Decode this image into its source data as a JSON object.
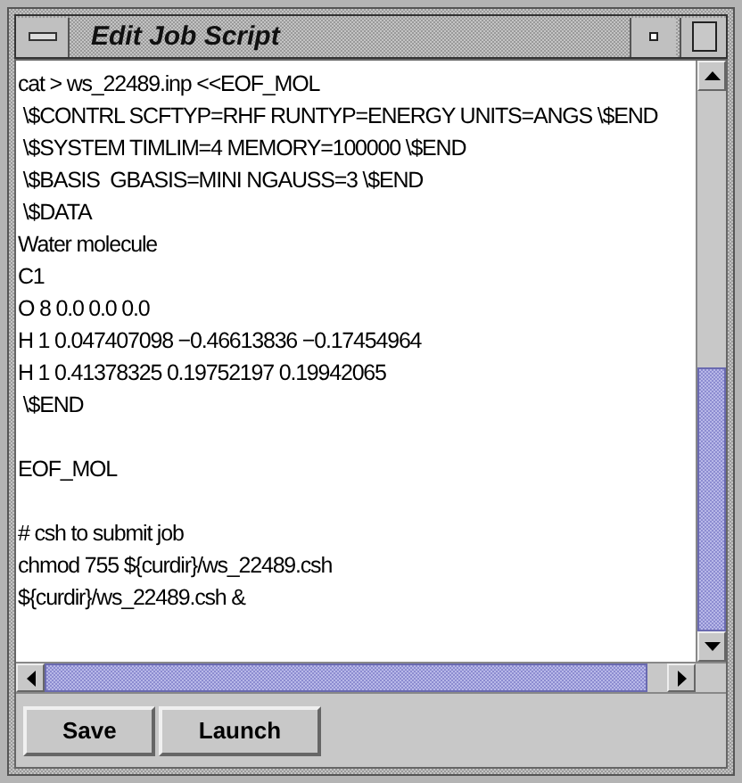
{
  "window": {
    "title": "Edit Job Script"
  },
  "editor": {
    "blocks": [
      [
        "cat > ws_22489.inp <<EOF_MOL",
        " \\$CONTRL SCFTYP=RHF RUNTYP=ENERGY UNITS=ANGS \\$END",
        " \\$SYSTEM TIMLIM=4 MEMORY=100000 \\$END",
        " \\$BASIS  GBASIS=MINI NGAUSS=3 \\$END",
        " \\$DATA",
        "Water molecule",
        "C1",
        "O 8 0.0 0.0 0.0",
        "H 1 0.047407098 −0.46613836 −0.17454964",
        "H 1 0.41378325 0.19752197 0.19942065",
        " \\$END"
      ],
      [
        "EOF_MOL"
      ],
      [
        "# csh to submit job",
        "chmod 755 ${curdir}/ws_22489.csh",
        "${curdir}/ws_22489.csh &"
      ]
    ]
  },
  "buttons": [
    {
      "label": "Save"
    },
    {
      "label": "Launch"
    }
  ]
}
